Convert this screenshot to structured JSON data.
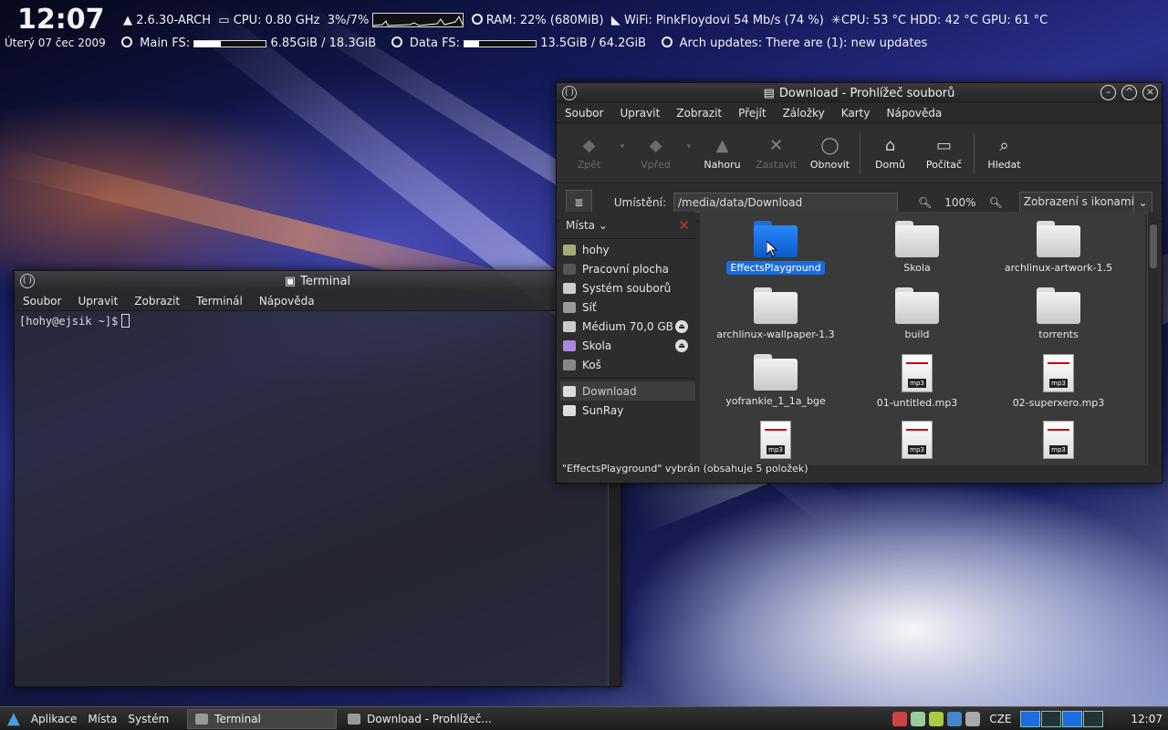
{
  "conky": {
    "time": "12:07",
    "date": "Úterý 07 čec 2009",
    "kernel": "2.6.30-ARCH",
    "cpu": "CPU: 0.80 GHz",
    "cpu_pct": "3%/7%",
    "ram": "RAM: 22% (680MiB)",
    "wifi": "WiFi: PinkFloydovi 54 Mb/s (74 %)",
    "temps": "CPU: 53 °C HDD: 42 °C GPU: 61 °C",
    "main_fs_label": "Main FS:",
    "main_fs_value": "6.85GiB / 18.3GiB",
    "main_fs_fraction": 0.37,
    "data_fs_label": "Data FS:",
    "data_fs_value": "13.5GiB / 64.2GiB",
    "data_fs_fraction": 0.21,
    "arch_updates": "Arch updates: There are (1): new updates"
  },
  "terminal": {
    "title": "Terminal",
    "menu": [
      "Soubor",
      "Upravit",
      "Zobrazit",
      "Terminál",
      "Nápověda"
    ],
    "prompt": "[hohy@ejsik ~]$"
  },
  "fm": {
    "title": "Download - Prohlížeč souborů",
    "menu": [
      "Soubor",
      "Upravit",
      "Zobrazit",
      "Přejít",
      "Záložky",
      "Karty",
      "Nápověda"
    ],
    "toolbar": {
      "back": "Zpět",
      "forward": "Vpřed",
      "up": "Nahoru",
      "stop": "Zastavit",
      "reload": "Obnovit",
      "home": "Domů",
      "computer": "Počítač",
      "search": "Hledat"
    },
    "location_label": "Umístění:",
    "location": "/media/data/Download",
    "zoom": "100%",
    "view_mode": "Zobrazení s ikonami",
    "places_label": "Místa",
    "places": [
      {
        "label": "hohy",
        "eject": false
      },
      {
        "label": "Pracovní plocha",
        "eject": false
      },
      {
        "label": "Systém souborů",
        "eject": false
      },
      {
        "label": "Síť",
        "eject": false
      },
      {
        "label": "Médium 70,0 GB",
        "eject": true
      },
      {
        "label": "Skola",
        "eject": true
      },
      {
        "label": "Koš",
        "eject": false
      }
    ],
    "bookmarks": [
      {
        "label": "Download",
        "selected": true
      },
      {
        "label": "SunRay",
        "selected": false
      }
    ],
    "files": [
      {
        "name": "EffectsPlayground",
        "type": "folder",
        "selected": true
      },
      {
        "name": "Skola",
        "type": "folder"
      },
      {
        "name": "archlinux-artwork-1.5",
        "type": "folder"
      },
      {
        "name": "archlinux-wallpaper-1.3",
        "type": "folder"
      },
      {
        "name": "build",
        "type": "folder"
      },
      {
        "name": "torrents",
        "type": "folder"
      },
      {
        "name": "yofrankie_1_1a_bge",
        "type": "folder"
      },
      {
        "name": "01-untitled.mp3",
        "type": "mp3"
      },
      {
        "name": "02-superxero.mp3",
        "type": "mp3"
      },
      {
        "name": "",
        "type": "mp3"
      },
      {
        "name": "",
        "type": "mp3"
      },
      {
        "name": "",
        "type": "mp3"
      }
    ],
    "mp3_badge": "mp3",
    "status": "\"EffectsPlayground\" vybrán (obsahuje 5 položek)"
  },
  "taskbar": {
    "menus": [
      "Aplikace",
      "Místa",
      "Systém"
    ],
    "tasks": [
      {
        "label": "Terminal",
        "active": true
      },
      {
        "label": "Download - Prohlížeč...",
        "active": false
      }
    ],
    "keyboard": "CZE",
    "clock": "12:07"
  }
}
